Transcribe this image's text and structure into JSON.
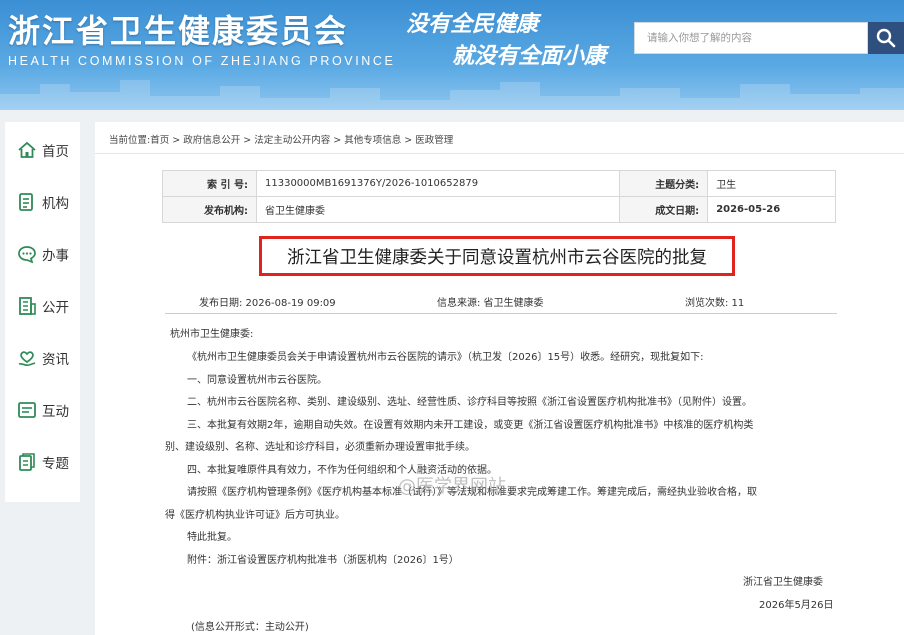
{
  "header": {
    "title": "浙江省卫生健康委员会",
    "subtitle": "HEALTH COMMISSION OF ZHEJIANG PROVINCE",
    "slogan_line1": "没有全民健康",
    "slogan_line2": "就没有全面小康",
    "search_placeholder": "请输入你想了解的内容"
  },
  "sidebar": {
    "items": [
      {
        "label": "首页",
        "icon": "home-icon"
      },
      {
        "label": "机构",
        "icon": "building-icon"
      },
      {
        "label": "办事",
        "icon": "chat-icon"
      },
      {
        "label": "公开",
        "icon": "document-icon"
      },
      {
        "label": "资讯",
        "icon": "hand-heart-icon"
      },
      {
        "label": "互动",
        "icon": "interaction-icon"
      },
      {
        "label": "专题",
        "icon": "topic-icon"
      }
    ]
  },
  "breadcrumb": "当前位置:首页 > 政府信息公开 > 法定主动公开内容 > 其他专项信息 > 医政管理",
  "meta": {
    "index_label": "索 引 号:",
    "index_value": "11330000MB1691376Y/2026-1010652879",
    "category_label": "主题分类:",
    "category_value": "卫生",
    "publisher_label": "发布机构:",
    "publisher_value": "省卫生健康委",
    "date_label": "成文日期:",
    "date_value": "2026-05-26"
  },
  "document": {
    "title": "浙江省卫生健康委关于同意设置杭州市云谷医院的批复",
    "publish_date": "发布日期:  2026-08-19 09:09",
    "source": "信息来源:  省卫生健康委",
    "views": "浏览次数:  11",
    "lines": [
      "杭州市卫生健康委:",
      "《杭州市卫生健康委员会关于申请设置杭州市云谷医院的请示》（杭卫发〔2026〕15号）收悉。经研究，现批复如下:",
      "一、同意设置杭州市云谷医院。",
      "二、杭州市云谷医院名称、类别、建设级别、选址、经营性质、诊疗科目等按照《浙江省设置医疗机构批准书》（见附件）设置。",
      "三、本批复有效期2年，逾期自动失效。在设置有效期内未开工建设，或变更《浙江省设置医疗机构批准书》中核准的医疗机构类",
      "别、建设级别、名称、选址和诊疗科目，必须重新办理设置审批手续。",
      "四、本批复唯原件具有效力，不作为任何组织和个人融资活动的依据。",
      "请按照《医疗机构管理条例》《医疗机构基本标准（试行）》等法规和标准要求完成筹建工作。筹建完成后，需经执业验收合格，取",
      "得《医疗机构执业许可证》后方可执业。",
      "特此批复。",
      "附件：浙江省设置医疗机构批准书（浙医机构〔2026〕1号）"
    ],
    "signature_org": "浙江省卫生健康委",
    "signature_date": "2026年5月26日",
    "disclosure": "(信息公开形式：主动公开)"
  },
  "watermark": "@医学界网站"
}
